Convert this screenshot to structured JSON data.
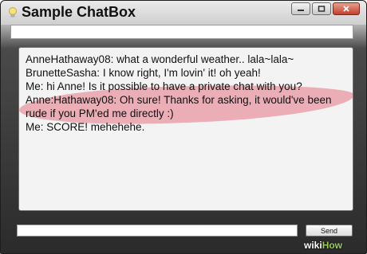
{
  "window": {
    "title": "Sample ChatBox",
    "icon": "lightbulb-icon",
    "controls": [
      "minimize-icon",
      "maximize-icon",
      "close-icon"
    ]
  },
  "top_input": {
    "value": ""
  },
  "chat": {
    "messages": [
      "AnneHathaway08: what a wonderful weather.. lala~lala~",
      "BrunetteSasha: I know right, I'm lovin' it! oh yeah!",
      "Me: hi Anne! Is it possible to have a private chat with you?",
      "Anne:Hathaway08: Oh sure! Thanks for asking, it would've been",
      "rude if you PM'ed me directly :)",
      "Me: SCORE! mehehehe."
    ],
    "highlight_color": "#e25a6e"
  },
  "composer": {
    "value": "",
    "send_label": "Send"
  },
  "watermark": {
    "part1": "wiki",
    "part2": "How"
  }
}
